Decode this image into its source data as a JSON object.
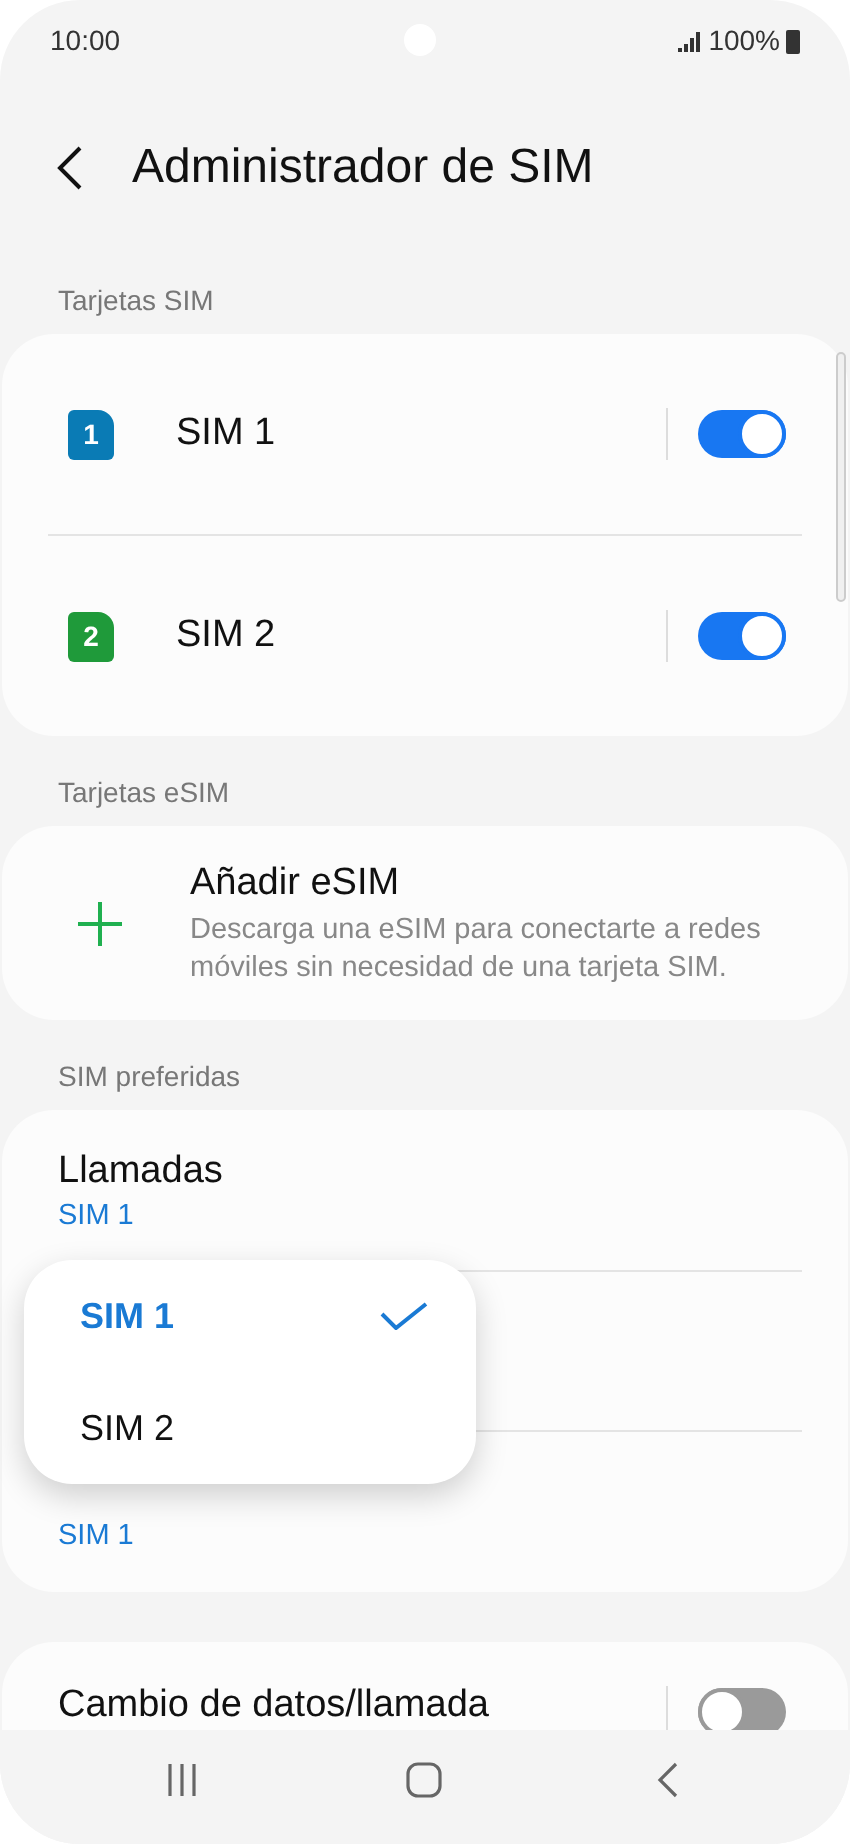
{
  "status_bar": {
    "time": "10:00",
    "battery": "100%"
  },
  "title": "Administrador de SIM",
  "sections": [
    {
      "header": "Tarjetas SIM",
      "kind": "sims",
      "items": [
        {
          "label": "SIM 1",
          "badge": "1",
          "color": "#0a7bb5",
          "on": true
        },
        {
          "label": "SIM 2",
          "badge": "2",
          "color": "#1f9a3a",
          "on": true
        }
      ]
    },
    {
      "header": "Tarjetas eSIM",
      "kind": "add",
      "title": "Añadir eSIM",
      "description": "Descarga una eSIM para conectarte a redes móviles sin necesidad de una tarjeta SIM."
    },
    {
      "header": "SIM preferidas",
      "kind": "prefs",
      "items": [
        {
          "title": "Llamadas",
          "value": "SIM 1"
        },
        {
          "value": "SIM 1"
        }
      ]
    },
    {
      "kind": "switch",
      "title": "Cambio de datos/llamada",
      "on": false
    }
  ],
  "popup": {
    "options": [
      {
        "label": "SIM 1",
        "selected": true
      },
      {
        "label": "SIM 2",
        "selected": false
      }
    ]
  }
}
